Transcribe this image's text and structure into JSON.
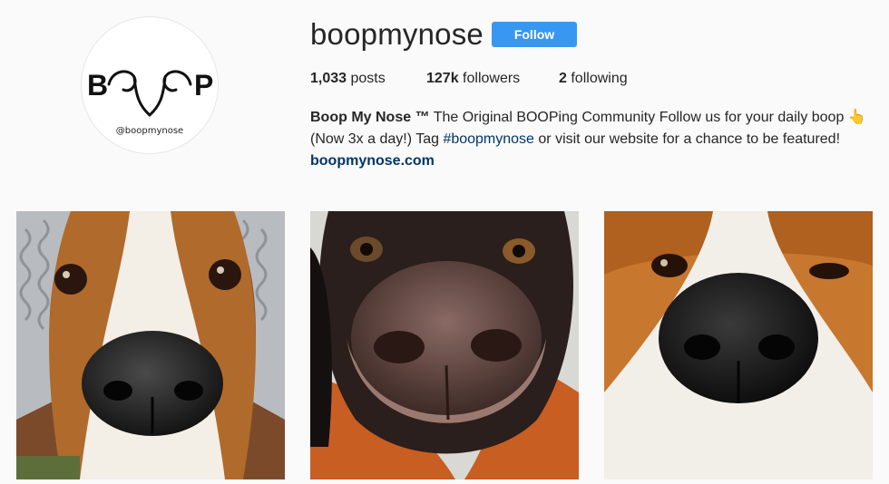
{
  "profile": {
    "username": "boopmynose",
    "follow_label": "Follow",
    "avatar": {
      "logo_letters_left": "B",
      "logo_letters_right": "P",
      "handle": "@boopmynose"
    },
    "stats": {
      "posts_count": "1,033",
      "posts_label": "posts",
      "followers_count": "127k",
      "followers_label": "followers",
      "following_count": "2",
      "following_label": "following"
    },
    "bio": {
      "name": "Boop My Nose ™",
      "text1": " The Original BOOPing Community Follow us for your daily boop ",
      "emoji": "👆",
      "text2": " (Now 3x a day!) Tag ",
      "hashtag": "#boopmynose",
      "text3": " or visit our website for a chance to be featured! ",
      "website": "boopmynose.com"
    }
  },
  "posts": [
    {
      "subject": "beagle-nose-with-knit-hat"
    },
    {
      "subject": "brown-dog-nose-on-orange-blanket"
    },
    {
      "subject": "corgi-nose-closeup"
    }
  ],
  "colors": {
    "background": "#fafafa",
    "follow_button": "#3897f0",
    "link": "#003569",
    "text": "#262626"
  }
}
